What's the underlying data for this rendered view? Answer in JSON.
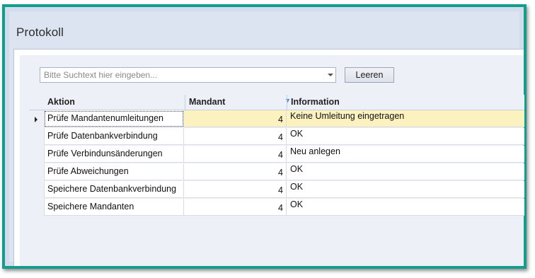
{
  "window": {
    "title": "Protokoll"
  },
  "search": {
    "placeholder": "Bitte Suchtext hier eingeben...",
    "value": ""
  },
  "toolbar": {
    "clear_label": "Leeren"
  },
  "grid": {
    "columns": [
      "Aktion",
      "Mandant",
      "Information"
    ],
    "rows": [
      {
        "aktion": "Prüfe Mandantenumleitungen",
        "mandant": "4",
        "information": "Keine Umleitung eingetragen"
      },
      {
        "aktion": "Prüfe Datenbankverbindung",
        "mandant": "4",
        "information": "OK"
      },
      {
        "aktion": "Prüfe Verbindunsänderungen",
        "mandant": "4",
        "information": "Neu anlegen"
      },
      {
        "aktion": "Prüfe Abweichungen",
        "mandant": "4",
        "information": "OK"
      },
      {
        "aktion": "Speichere Datenbankverbindung",
        "mandant": "4",
        "information": "OK"
      },
      {
        "aktion": "Speichere Mandanten",
        "mandant": "4",
        "information": "OK"
      }
    ],
    "selected_row": 0
  },
  "colors": {
    "frame": "#129e8d",
    "selection": "#fcf2bf",
    "filter_icon": "#2d8fde"
  },
  "icons": [
    "dropdown-arrow-icon",
    "filter-icon",
    "row-indicator-icon"
  ]
}
